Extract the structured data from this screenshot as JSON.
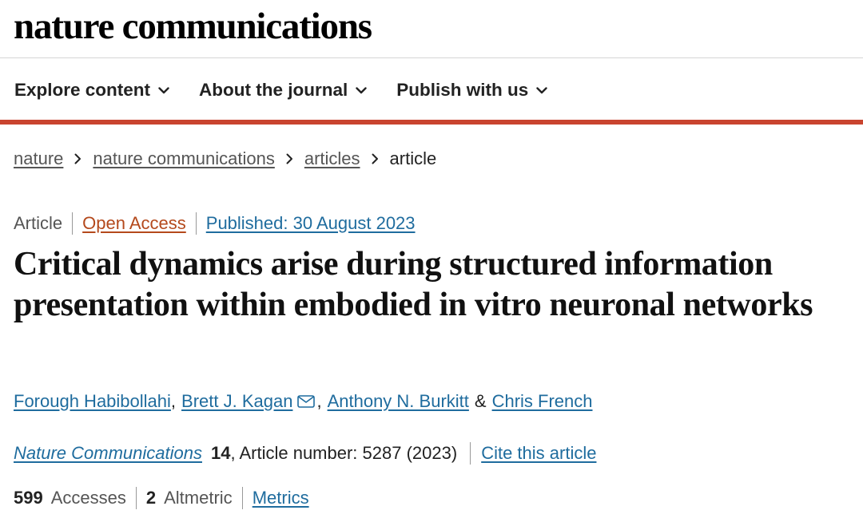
{
  "header": {
    "logo_text": "nature communications"
  },
  "nav": [
    {
      "label": "Explore content"
    },
    {
      "label": "About the journal"
    },
    {
      "label": "Publish with us"
    }
  ],
  "breadcrumb": {
    "items": [
      "nature",
      "nature communications",
      "articles"
    ],
    "current": "article",
    "separator": ">"
  },
  "article": {
    "type": "Article",
    "access": "Open Access",
    "published": "Published: 30 August 2023",
    "title": "Critical dynamics arise during structured information presentation within embodied in vitro neuronal networks",
    "authors": [
      "Forough Habibollahi",
      "Brett J. Kagan",
      "Anthony N. Burkitt",
      "Chris French"
    ],
    "author_comma": ",",
    "author_and": "&",
    "journal": "Nature Communications",
    "volume": "14",
    "article_number": ", Article number: 5287 (2023)",
    "cite_label": "Cite this article",
    "accesses_count": "599",
    "accesses_label": "Accesses",
    "altmetric_count": "2",
    "altmetric_label": "Altmetric",
    "metrics_label": "Metrics"
  },
  "colors": {
    "accent_red": "#c9442f",
    "link_blue": "#1f6c9e",
    "open_access_orange": "#b4491c"
  },
  "icons": {
    "nav_chevron": "chevron-down-icon",
    "breadcrumb_sep": "chevron-right-icon",
    "corresponding_author": "mail-icon"
  }
}
